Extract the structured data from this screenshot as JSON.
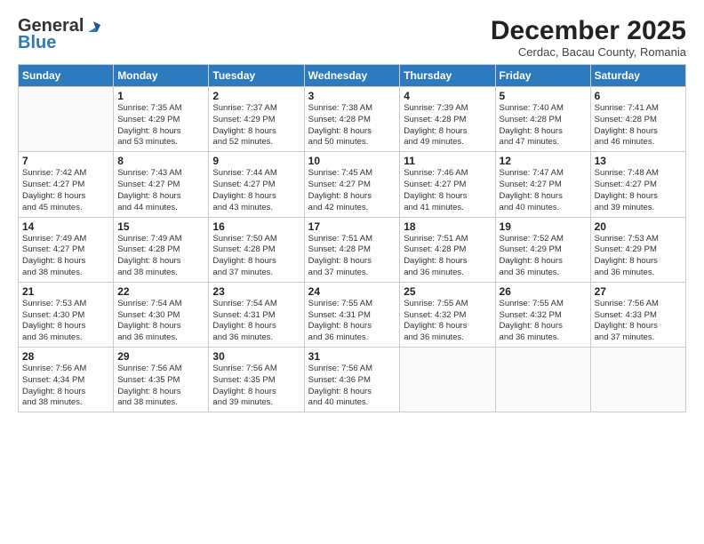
{
  "logo": {
    "line1": "General",
    "line2": "Blue"
  },
  "title": "December 2025",
  "subtitle": "Cerdac, Bacau County, Romania",
  "days_of_week": [
    "Sunday",
    "Monday",
    "Tuesday",
    "Wednesday",
    "Thursday",
    "Friday",
    "Saturday"
  ],
  "weeks": [
    [
      {
        "day": "",
        "info": ""
      },
      {
        "day": "1",
        "info": "Sunrise: 7:35 AM\nSunset: 4:29 PM\nDaylight: 8 hours\nand 53 minutes."
      },
      {
        "day": "2",
        "info": "Sunrise: 7:37 AM\nSunset: 4:29 PM\nDaylight: 8 hours\nand 52 minutes."
      },
      {
        "day": "3",
        "info": "Sunrise: 7:38 AM\nSunset: 4:28 PM\nDaylight: 8 hours\nand 50 minutes."
      },
      {
        "day": "4",
        "info": "Sunrise: 7:39 AM\nSunset: 4:28 PM\nDaylight: 8 hours\nand 49 minutes."
      },
      {
        "day": "5",
        "info": "Sunrise: 7:40 AM\nSunset: 4:28 PM\nDaylight: 8 hours\nand 47 minutes."
      },
      {
        "day": "6",
        "info": "Sunrise: 7:41 AM\nSunset: 4:28 PM\nDaylight: 8 hours\nand 46 minutes."
      }
    ],
    [
      {
        "day": "7",
        "info": "Sunrise: 7:42 AM\nSunset: 4:27 PM\nDaylight: 8 hours\nand 45 minutes."
      },
      {
        "day": "8",
        "info": "Sunrise: 7:43 AM\nSunset: 4:27 PM\nDaylight: 8 hours\nand 44 minutes."
      },
      {
        "day": "9",
        "info": "Sunrise: 7:44 AM\nSunset: 4:27 PM\nDaylight: 8 hours\nand 43 minutes."
      },
      {
        "day": "10",
        "info": "Sunrise: 7:45 AM\nSunset: 4:27 PM\nDaylight: 8 hours\nand 42 minutes."
      },
      {
        "day": "11",
        "info": "Sunrise: 7:46 AM\nSunset: 4:27 PM\nDaylight: 8 hours\nand 41 minutes."
      },
      {
        "day": "12",
        "info": "Sunrise: 7:47 AM\nSunset: 4:27 PM\nDaylight: 8 hours\nand 40 minutes."
      },
      {
        "day": "13",
        "info": "Sunrise: 7:48 AM\nSunset: 4:27 PM\nDaylight: 8 hours\nand 39 minutes."
      }
    ],
    [
      {
        "day": "14",
        "info": "Sunrise: 7:49 AM\nSunset: 4:27 PM\nDaylight: 8 hours\nand 38 minutes."
      },
      {
        "day": "15",
        "info": "Sunrise: 7:49 AM\nSunset: 4:28 PM\nDaylight: 8 hours\nand 38 minutes."
      },
      {
        "day": "16",
        "info": "Sunrise: 7:50 AM\nSunset: 4:28 PM\nDaylight: 8 hours\nand 37 minutes."
      },
      {
        "day": "17",
        "info": "Sunrise: 7:51 AM\nSunset: 4:28 PM\nDaylight: 8 hours\nand 37 minutes."
      },
      {
        "day": "18",
        "info": "Sunrise: 7:51 AM\nSunset: 4:28 PM\nDaylight: 8 hours\nand 36 minutes."
      },
      {
        "day": "19",
        "info": "Sunrise: 7:52 AM\nSunset: 4:29 PM\nDaylight: 8 hours\nand 36 minutes."
      },
      {
        "day": "20",
        "info": "Sunrise: 7:53 AM\nSunset: 4:29 PM\nDaylight: 8 hours\nand 36 minutes."
      }
    ],
    [
      {
        "day": "21",
        "info": "Sunrise: 7:53 AM\nSunset: 4:30 PM\nDaylight: 8 hours\nand 36 minutes."
      },
      {
        "day": "22",
        "info": "Sunrise: 7:54 AM\nSunset: 4:30 PM\nDaylight: 8 hours\nand 36 minutes."
      },
      {
        "day": "23",
        "info": "Sunrise: 7:54 AM\nSunset: 4:31 PM\nDaylight: 8 hours\nand 36 minutes."
      },
      {
        "day": "24",
        "info": "Sunrise: 7:55 AM\nSunset: 4:31 PM\nDaylight: 8 hours\nand 36 minutes."
      },
      {
        "day": "25",
        "info": "Sunrise: 7:55 AM\nSunset: 4:32 PM\nDaylight: 8 hours\nand 36 minutes."
      },
      {
        "day": "26",
        "info": "Sunrise: 7:55 AM\nSunset: 4:32 PM\nDaylight: 8 hours\nand 36 minutes."
      },
      {
        "day": "27",
        "info": "Sunrise: 7:56 AM\nSunset: 4:33 PM\nDaylight: 8 hours\nand 37 minutes."
      }
    ],
    [
      {
        "day": "28",
        "info": "Sunrise: 7:56 AM\nSunset: 4:34 PM\nDaylight: 8 hours\nand 38 minutes."
      },
      {
        "day": "29",
        "info": "Sunrise: 7:56 AM\nSunset: 4:35 PM\nDaylight: 8 hours\nand 38 minutes."
      },
      {
        "day": "30",
        "info": "Sunrise: 7:56 AM\nSunset: 4:35 PM\nDaylight: 8 hours\nand 39 minutes."
      },
      {
        "day": "31",
        "info": "Sunrise: 7:56 AM\nSunset: 4:36 PM\nDaylight: 8 hours\nand 40 minutes."
      },
      {
        "day": "",
        "info": ""
      },
      {
        "day": "",
        "info": ""
      },
      {
        "day": "",
        "info": ""
      }
    ]
  ]
}
